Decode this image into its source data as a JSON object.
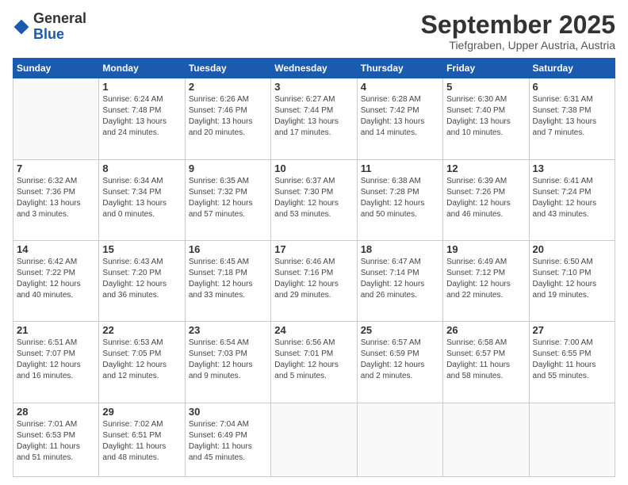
{
  "logo": {
    "general": "General",
    "blue": "Blue"
  },
  "header": {
    "month": "September 2025",
    "location": "Tiefgraben, Upper Austria, Austria"
  },
  "weekdays": [
    "Sunday",
    "Monday",
    "Tuesday",
    "Wednesday",
    "Thursday",
    "Friday",
    "Saturday"
  ],
  "weeks": [
    [
      {
        "day": "",
        "info": ""
      },
      {
        "day": "1",
        "info": "Sunrise: 6:24 AM\nSunset: 7:48 PM\nDaylight: 13 hours\nand 24 minutes."
      },
      {
        "day": "2",
        "info": "Sunrise: 6:26 AM\nSunset: 7:46 PM\nDaylight: 13 hours\nand 20 minutes."
      },
      {
        "day": "3",
        "info": "Sunrise: 6:27 AM\nSunset: 7:44 PM\nDaylight: 13 hours\nand 17 minutes."
      },
      {
        "day": "4",
        "info": "Sunrise: 6:28 AM\nSunset: 7:42 PM\nDaylight: 13 hours\nand 14 minutes."
      },
      {
        "day": "5",
        "info": "Sunrise: 6:30 AM\nSunset: 7:40 PM\nDaylight: 13 hours\nand 10 minutes."
      },
      {
        "day": "6",
        "info": "Sunrise: 6:31 AM\nSunset: 7:38 PM\nDaylight: 13 hours\nand 7 minutes."
      }
    ],
    [
      {
        "day": "7",
        "info": "Sunrise: 6:32 AM\nSunset: 7:36 PM\nDaylight: 13 hours\nand 3 minutes."
      },
      {
        "day": "8",
        "info": "Sunrise: 6:34 AM\nSunset: 7:34 PM\nDaylight: 13 hours\nand 0 minutes."
      },
      {
        "day": "9",
        "info": "Sunrise: 6:35 AM\nSunset: 7:32 PM\nDaylight: 12 hours\nand 57 minutes."
      },
      {
        "day": "10",
        "info": "Sunrise: 6:37 AM\nSunset: 7:30 PM\nDaylight: 12 hours\nand 53 minutes."
      },
      {
        "day": "11",
        "info": "Sunrise: 6:38 AM\nSunset: 7:28 PM\nDaylight: 12 hours\nand 50 minutes."
      },
      {
        "day": "12",
        "info": "Sunrise: 6:39 AM\nSunset: 7:26 PM\nDaylight: 12 hours\nand 46 minutes."
      },
      {
        "day": "13",
        "info": "Sunrise: 6:41 AM\nSunset: 7:24 PM\nDaylight: 12 hours\nand 43 minutes."
      }
    ],
    [
      {
        "day": "14",
        "info": "Sunrise: 6:42 AM\nSunset: 7:22 PM\nDaylight: 12 hours\nand 40 minutes."
      },
      {
        "day": "15",
        "info": "Sunrise: 6:43 AM\nSunset: 7:20 PM\nDaylight: 12 hours\nand 36 minutes."
      },
      {
        "day": "16",
        "info": "Sunrise: 6:45 AM\nSunset: 7:18 PM\nDaylight: 12 hours\nand 33 minutes."
      },
      {
        "day": "17",
        "info": "Sunrise: 6:46 AM\nSunset: 7:16 PM\nDaylight: 12 hours\nand 29 minutes."
      },
      {
        "day": "18",
        "info": "Sunrise: 6:47 AM\nSunset: 7:14 PM\nDaylight: 12 hours\nand 26 minutes."
      },
      {
        "day": "19",
        "info": "Sunrise: 6:49 AM\nSunset: 7:12 PM\nDaylight: 12 hours\nand 22 minutes."
      },
      {
        "day": "20",
        "info": "Sunrise: 6:50 AM\nSunset: 7:10 PM\nDaylight: 12 hours\nand 19 minutes."
      }
    ],
    [
      {
        "day": "21",
        "info": "Sunrise: 6:51 AM\nSunset: 7:07 PM\nDaylight: 12 hours\nand 16 minutes."
      },
      {
        "day": "22",
        "info": "Sunrise: 6:53 AM\nSunset: 7:05 PM\nDaylight: 12 hours\nand 12 minutes."
      },
      {
        "day": "23",
        "info": "Sunrise: 6:54 AM\nSunset: 7:03 PM\nDaylight: 12 hours\nand 9 minutes."
      },
      {
        "day": "24",
        "info": "Sunrise: 6:56 AM\nSunset: 7:01 PM\nDaylight: 12 hours\nand 5 minutes."
      },
      {
        "day": "25",
        "info": "Sunrise: 6:57 AM\nSunset: 6:59 PM\nDaylight: 12 hours\nand 2 minutes."
      },
      {
        "day": "26",
        "info": "Sunrise: 6:58 AM\nSunset: 6:57 PM\nDaylight: 11 hours\nand 58 minutes."
      },
      {
        "day": "27",
        "info": "Sunrise: 7:00 AM\nSunset: 6:55 PM\nDaylight: 11 hours\nand 55 minutes."
      }
    ],
    [
      {
        "day": "28",
        "info": "Sunrise: 7:01 AM\nSunset: 6:53 PM\nDaylight: 11 hours\nand 51 minutes."
      },
      {
        "day": "29",
        "info": "Sunrise: 7:02 AM\nSunset: 6:51 PM\nDaylight: 11 hours\nand 48 minutes."
      },
      {
        "day": "30",
        "info": "Sunrise: 7:04 AM\nSunset: 6:49 PM\nDaylight: 11 hours\nand 45 minutes."
      },
      {
        "day": "",
        "info": ""
      },
      {
        "day": "",
        "info": ""
      },
      {
        "day": "",
        "info": ""
      },
      {
        "day": "",
        "info": ""
      }
    ]
  ]
}
